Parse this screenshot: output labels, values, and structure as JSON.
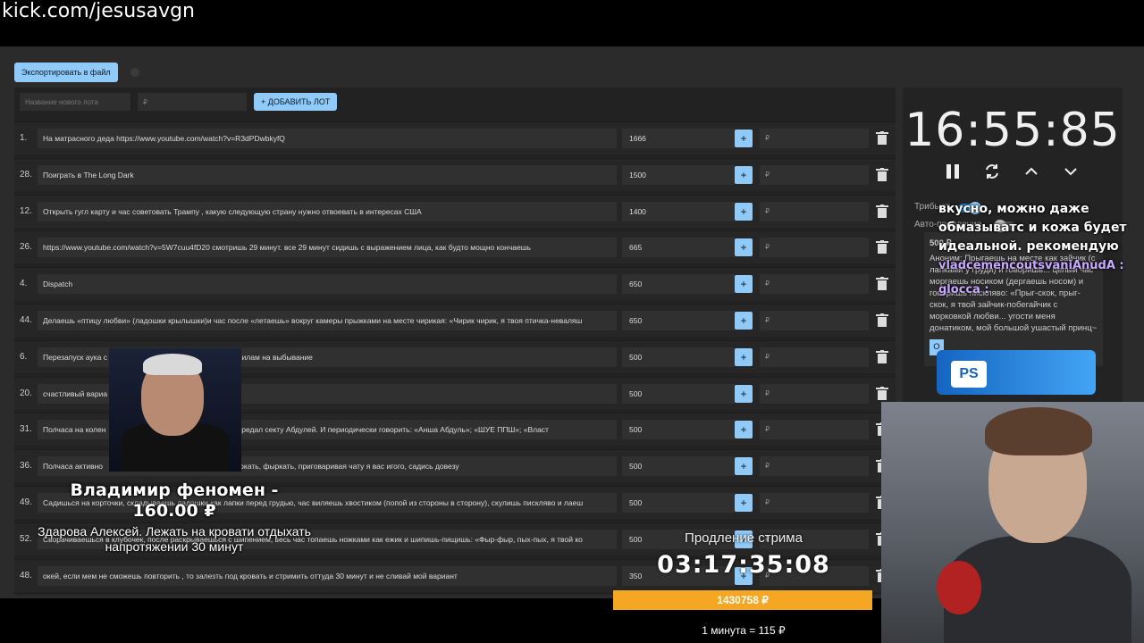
{
  "url": "kick.com/jesusavgn",
  "toolbar": {
    "export_label": "Экспортировать в файл"
  },
  "add_lot": {
    "name_placeholder": "Название нового лота",
    "amount_placeholder": "₽",
    "add_label": "+ ДОБАВИТЬ ЛОТ"
  },
  "lots": [
    {
      "num": "1.",
      "name": "На матрасного деда https://www.youtube.com/watch?v=R3dPDwbkyfQ",
      "amount": "1666"
    },
    {
      "num": "28.",
      "name": "Поиграть в The Long Dark",
      "amount": "1500"
    },
    {
      "num": "12.",
      "name": "Открыть гугл карту и час советовать Трампу , какую следующую страну нужно отвоевать в интересах США",
      "amount": "1400"
    },
    {
      "num": "26.",
      "name": "https://www.youtube.com/watch?v=5W7cuu4fD20 смотришь 29 минут. все 29 минут сидишь с выражением лица, как будто мощно кончаешь",
      "amount": "665"
    },
    {
      "num": "4.",
      "name": "Dispatch",
      "amount": "650"
    },
    {
      "num": "44.",
      "name": "Делаешь «птицу любви» (ладошки крылышки)и час после «летаешь» вокруг камеры прыжками на месте чирикая: «Чирик чирик, я твоя птичка-неваляш",
      "amount": "650"
    },
    {
      "num": "6.",
      "name": "Перезапуск аука с",
      "name2": "ук по правилам на выбывание",
      "amount": "500"
    },
    {
      "num": "20.",
      "name": "счастливый вариа",
      "amount": "500"
    },
    {
      "num": "31.",
      "name": "Полчаса на колен",
      "name2": "за то что предал секту Абдулей. И периодически говорить: «Анша Абдуль»; «ШУЕ ППШ»; «Власт",
      "amount": "500"
    },
    {
      "num": "36.",
      "name": "Полчаса активно",
      "name2": "конюшку, цокать, фыркать, приговаривая чату я вас игого, садись довезу",
      "amount": "500"
    },
    {
      "num": "49.",
      "name": "Садишься на корточки, складываешь ладошки как лапки перед грудью, час виляешь хвостиком (попой из стороны в сторону), скулишь писклявo и лаеш",
      "amount": "500"
    },
    {
      "num": "52.",
      "name": "Сворачиваешься в клубочек, после раскрываешься с шипением, весь час топаешь ножками как ежик и шипишь-пищишь: «Фыр-фыр, пых-пых, я твой ко",
      "amount": "500"
    },
    {
      "num": "48.",
      "name": "окей, если мем не сможешь повторить , то залезть под кровать и стримить оттуда 30 минут и не сливай мой вариант",
      "amount": "350"
    }
  ],
  "rub_placeholder": "₽",
  "timer": {
    "value": "16:55:85"
  },
  "side": {
    "tribute_label": "Трибьют",
    "auto_extend_label": "Авто-продление",
    "card_amount": "500 ₽",
    "card_text": "Аноним: Прыгаешь на месте как зайчик (с лапками у груди) и говоришь... целый час моргаешь носиком (дергаешь носом) и говоришь писклявo: «Прыг-скок, прыг-скок, я твой зайчик-побегайчик с морковкой любви... угости меня донатиком, мой большой ушастый принц~",
    "card_button": "О"
  },
  "chat": {
    "line1": "вкусно, можно даже",
    "line2": "обмазыватс и кожа будет",
    "line3": "идеальной. рекомендую",
    "nick1": "vladcemencoutsvaniAnudA :",
    "nick2": "glocca :"
  },
  "ps_logo": "PS",
  "donation": {
    "title": "Владимир феномен -",
    "amount": "160.00 ₽",
    "message": "Здарова Алексей. Лежать на кровати отдыхать напротяжении 30 минут"
  },
  "extension": {
    "title": "Продление стрима",
    "time": "03:17:35:08",
    "bank": "1430758 ₽",
    "rate": "1 минута = 115 ₽"
  },
  "colors": {
    "accent": "#90caf9",
    "bank": "#f5a623",
    "panel": "#222222"
  }
}
